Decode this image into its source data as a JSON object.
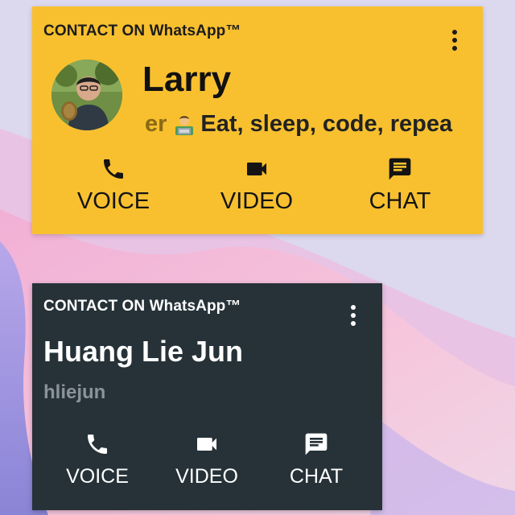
{
  "wallpaper": {
    "colors": [
      "#dcd8ee",
      "#f3b7d9",
      "#b9a4e6",
      "#8c86d8",
      "#f7c8df"
    ]
  },
  "widgets": [
    {
      "header": "CONTACT ON WhatsApp™",
      "name": "Larry",
      "status": {
        "lead_fragment": "er",
        "emoji": "technologist-emoji",
        "text": "Eat, sleep, code, repea"
      },
      "actions": [
        {
          "label": "VOICE",
          "icon": "phone-icon"
        },
        {
          "label": "VIDEO",
          "icon": "video-camera-icon"
        },
        {
          "label": "CHAT",
          "icon": "chat-bubble-icon"
        }
      ],
      "colors": {
        "background": "#f8c02f",
        "text": "#141414"
      }
    },
    {
      "header": "CONTACT ON WhatsApp™",
      "name": "Huang Lie Jun",
      "username": "hliejun",
      "actions": [
        {
          "label": "VOICE",
          "icon": "phone-icon"
        },
        {
          "label": "VIDEO",
          "icon": "video-camera-icon"
        },
        {
          "label": "CHAT",
          "icon": "chat-bubble-icon"
        }
      ],
      "colors": {
        "background": "#263238",
        "text": "#ffffff",
        "muted": "#8a9399"
      }
    }
  ]
}
